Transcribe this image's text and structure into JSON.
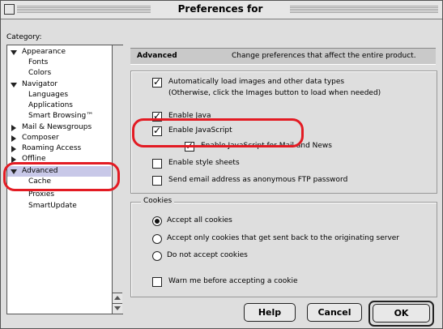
{
  "window": {
    "title": "Preferences for"
  },
  "category": {
    "label": "Category:",
    "items": [
      {
        "label": "Appearance",
        "expander": "expanded"
      },
      {
        "label": "Fonts"
      },
      {
        "label": "Colors"
      },
      {
        "label": "Navigator",
        "expander": "expanded"
      },
      {
        "label": "Languages"
      },
      {
        "label": "Applications"
      },
      {
        "label": "Smart Browsing™"
      },
      {
        "label": "Mail & Newsgroups",
        "expander": "collapsed"
      },
      {
        "label": "Composer",
        "expander": "collapsed"
      },
      {
        "label": "Roaming Access",
        "expander": "collapsed"
      },
      {
        "label": "Offline",
        "expander": "collapsed"
      },
      {
        "label": "Advanced",
        "expander": "expanded",
        "selected": true
      },
      {
        "label": "Cache"
      },
      {
        "label": "Proxies"
      },
      {
        "label": "SmartUpdate"
      }
    ]
  },
  "panel": {
    "title": "Advanced",
    "description": "Change preferences that affect the entire product."
  },
  "options": {
    "auto_load_line1": "Automatically load images and other data types",
    "auto_load_line2": "(Otherwise, click the Images button to load when needed)",
    "enable_java": "Enable Java",
    "enable_javascript": "Enable JavaScript",
    "enable_javascript_mail": "Enable JavaScript for Mail and News",
    "enable_style_sheets": "Enable style sheets",
    "send_email_ftp": "Send email address as anonymous FTP password"
  },
  "cookies": {
    "label": "Cookies",
    "accept_all": "Accept all cookies",
    "accept_originating": "Accept only cookies that get sent back to the originating server",
    "do_not_accept": "Do not accept cookies",
    "warn": "Warn me before accepting a cookie"
  },
  "buttons": {
    "help": "Help",
    "cancel": "Cancel",
    "ok": "OK"
  },
  "colors": {
    "highlight": "#e31b23",
    "selection": "#c8c8e8"
  }
}
